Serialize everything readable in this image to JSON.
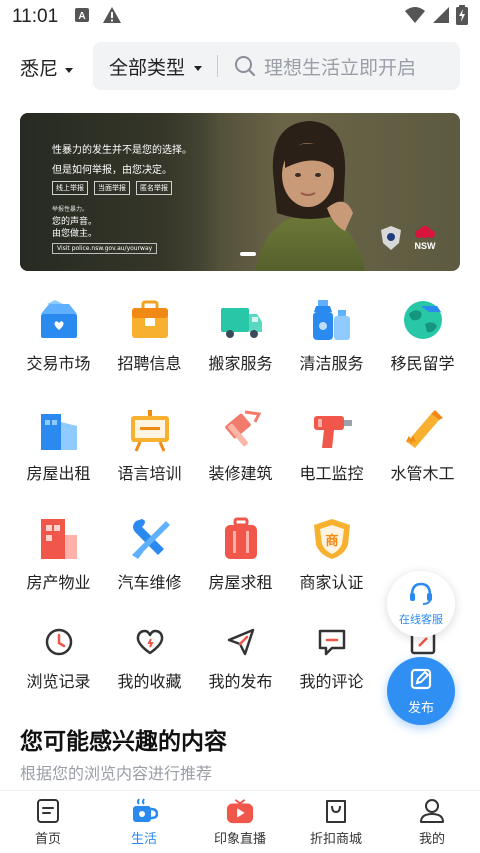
{
  "status_bar": {
    "time": "11:01",
    "icons": [
      "notification-a-icon",
      "warning-icon",
      "wifi-icon",
      "signal-icon",
      "battery-charging-icon"
    ]
  },
  "header": {
    "city": "悉尼",
    "type_filter": "全部类型",
    "search_placeholder": "理想生活立即开启"
  },
  "banner": {
    "line1": "性暴力的发生并不是您的选择。",
    "line2": "但是如何举报，由您决定。",
    "chips": [
      "线上举报",
      "当面举报",
      "匿名举报"
    ],
    "small": "举报性暴力。",
    "voice1": "您的声音。",
    "voice2": "由您做主。",
    "url": "Visit police.nsw.gov.au/yourway",
    "nsw": "NSW"
  },
  "categories": [
    {
      "label": "交易市场",
      "icon": "shopping-box-icon"
    },
    {
      "label": "招聘信息",
      "icon": "briefcase-icon"
    },
    {
      "label": "搬家服务",
      "icon": "moving-truck-icon"
    },
    {
      "label": "清洁服务",
      "icon": "cleaning-spray-icon"
    },
    {
      "label": "移民留学",
      "icon": "globe-icon"
    },
    {
      "label": "房屋出租",
      "icon": "building-icon"
    },
    {
      "label": "语言培训",
      "icon": "easel-board-icon"
    },
    {
      "label": "装修建筑",
      "icon": "paint-roller-icon"
    },
    {
      "label": "电工监控",
      "icon": "drill-icon"
    },
    {
      "label": "水管木工",
      "icon": "saw-icon"
    },
    {
      "label": "房产物业",
      "icon": "apartment-icon"
    },
    {
      "label": "汽车维修",
      "icon": "wrench-screwdriver-icon"
    },
    {
      "label": "房屋求租",
      "icon": "suitcase-icon"
    },
    {
      "label": "商家认证",
      "icon": "merchant-shield-icon"
    }
  ],
  "personal": [
    {
      "label": "浏览记录",
      "icon": "clock-icon"
    },
    {
      "label": "我的收藏",
      "icon": "heart-icon"
    },
    {
      "label": "我的发布",
      "icon": "paper-plane-icon"
    },
    {
      "label": "我的评论",
      "icon": "comment-icon"
    },
    {
      "label": "",
      "icon": "edit-note-icon"
    }
  ],
  "floating": {
    "service_label": "在线客服",
    "publish_label": "发布"
  },
  "recommend": {
    "title": "您可能感兴趣的内容",
    "subtitle": "根据您的浏览内容进行推荐"
  },
  "nav": [
    {
      "label": "首页",
      "icon": "home-doc-icon"
    },
    {
      "label": "生活",
      "icon": "coffee-cup-icon",
      "active": true
    },
    {
      "label": "印象直播",
      "icon": "live-tv-icon"
    },
    {
      "label": "折扣商城",
      "icon": "shopping-bag-icon"
    },
    {
      "label": "我的",
      "icon": "user-icon"
    }
  ],
  "colors": {
    "accent": "#2a8af0",
    "search_bg": "#f2f3f5",
    "placeholder": "#9a9ea6"
  }
}
